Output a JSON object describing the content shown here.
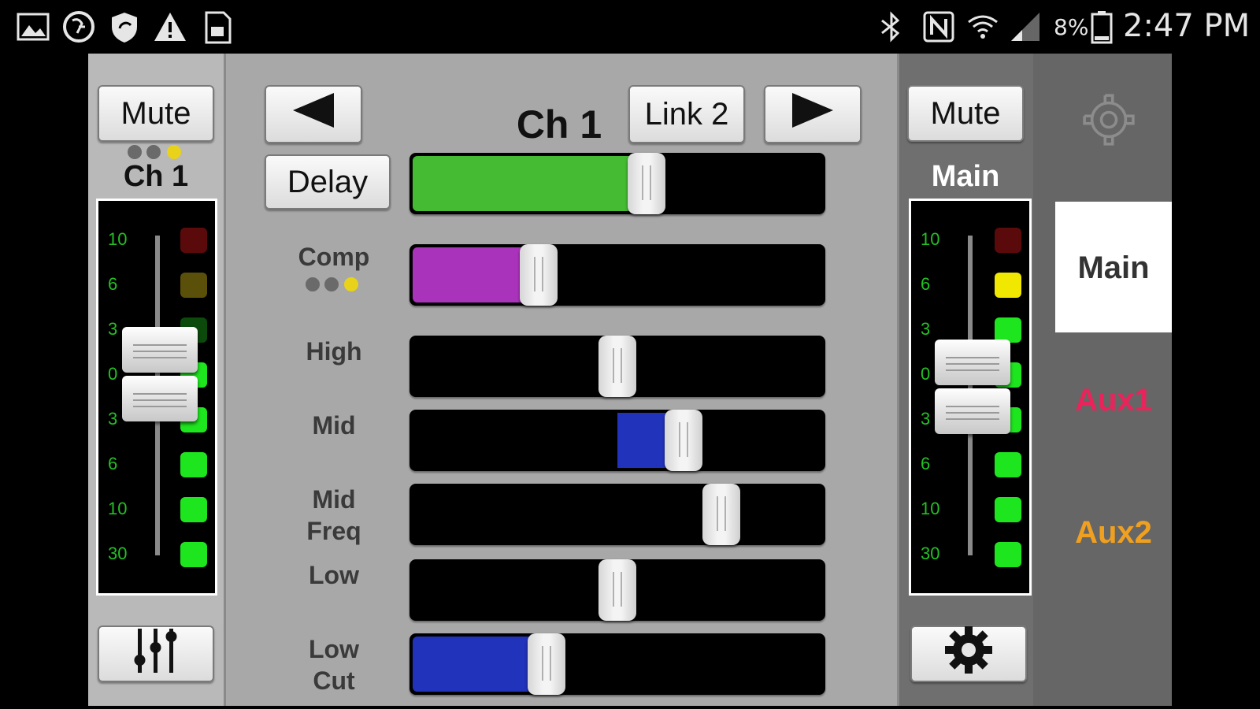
{
  "status_bar": {
    "battery": "8%",
    "time": "2:47 PM",
    "left_icons": [
      "gallery-icon",
      "download-icon",
      "shield-sync-icon",
      "warning-icon",
      "document-icon"
    ],
    "right_icons": [
      "bluetooth-icon",
      "nfc-icon",
      "wifi-icon",
      "signal-icon",
      "battery-icon"
    ]
  },
  "left_strip": {
    "mute_label": "Mute",
    "channel_label": "Ch 1",
    "scale": [
      "10",
      "6",
      "3",
      "0",
      "3",
      "6",
      "10",
      "30"
    ],
    "mixer_icon": "mixer-sliders-icon"
  },
  "center": {
    "prev_icon": "left-arrow-icon",
    "next_icon": "right-arrow-icon",
    "channel_title": "Ch 1",
    "link_label": "Link 2",
    "delay_label": "Delay",
    "sliders": [
      {
        "name": "delay",
        "label": "",
        "value": 0.57,
        "fill": "#44bb33"
      },
      {
        "name": "comp",
        "label": "Comp",
        "value": 0.31,
        "fill": "#aa33bb"
      },
      {
        "name": "high",
        "label": "High",
        "value": 0.5,
        "fill": ""
      },
      {
        "name": "mid",
        "label": "Mid",
        "value": 0.66,
        "fill": "#2233bb"
      },
      {
        "name": "mid-freq",
        "label": "Mid\nFreq",
        "value": 0.75,
        "fill": ""
      },
      {
        "name": "low",
        "label": "Low",
        "value": 0.5,
        "fill": ""
      },
      {
        "name": "low-cut",
        "label": "Low\nCut",
        "value": 0.33,
        "fill": "#2233bb"
      }
    ]
  },
  "right_strip": {
    "mute_label": "Mute",
    "bus_label": "Main",
    "scale": [
      "10",
      "6",
      "3",
      "0",
      "3",
      "6",
      "10",
      "30"
    ],
    "settings_icon": "gear-icon"
  },
  "bus_panel": {
    "settings_icon": "gear-outline-icon",
    "buses": [
      {
        "label": "Main",
        "color": "#333333",
        "selected": true
      },
      {
        "label": "Aux1",
        "color": "#e8245a",
        "selected": false
      },
      {
        "label": "Aux2",
        "color": "#f0a020",
        "selected": false
      }
    ]
  }
}
